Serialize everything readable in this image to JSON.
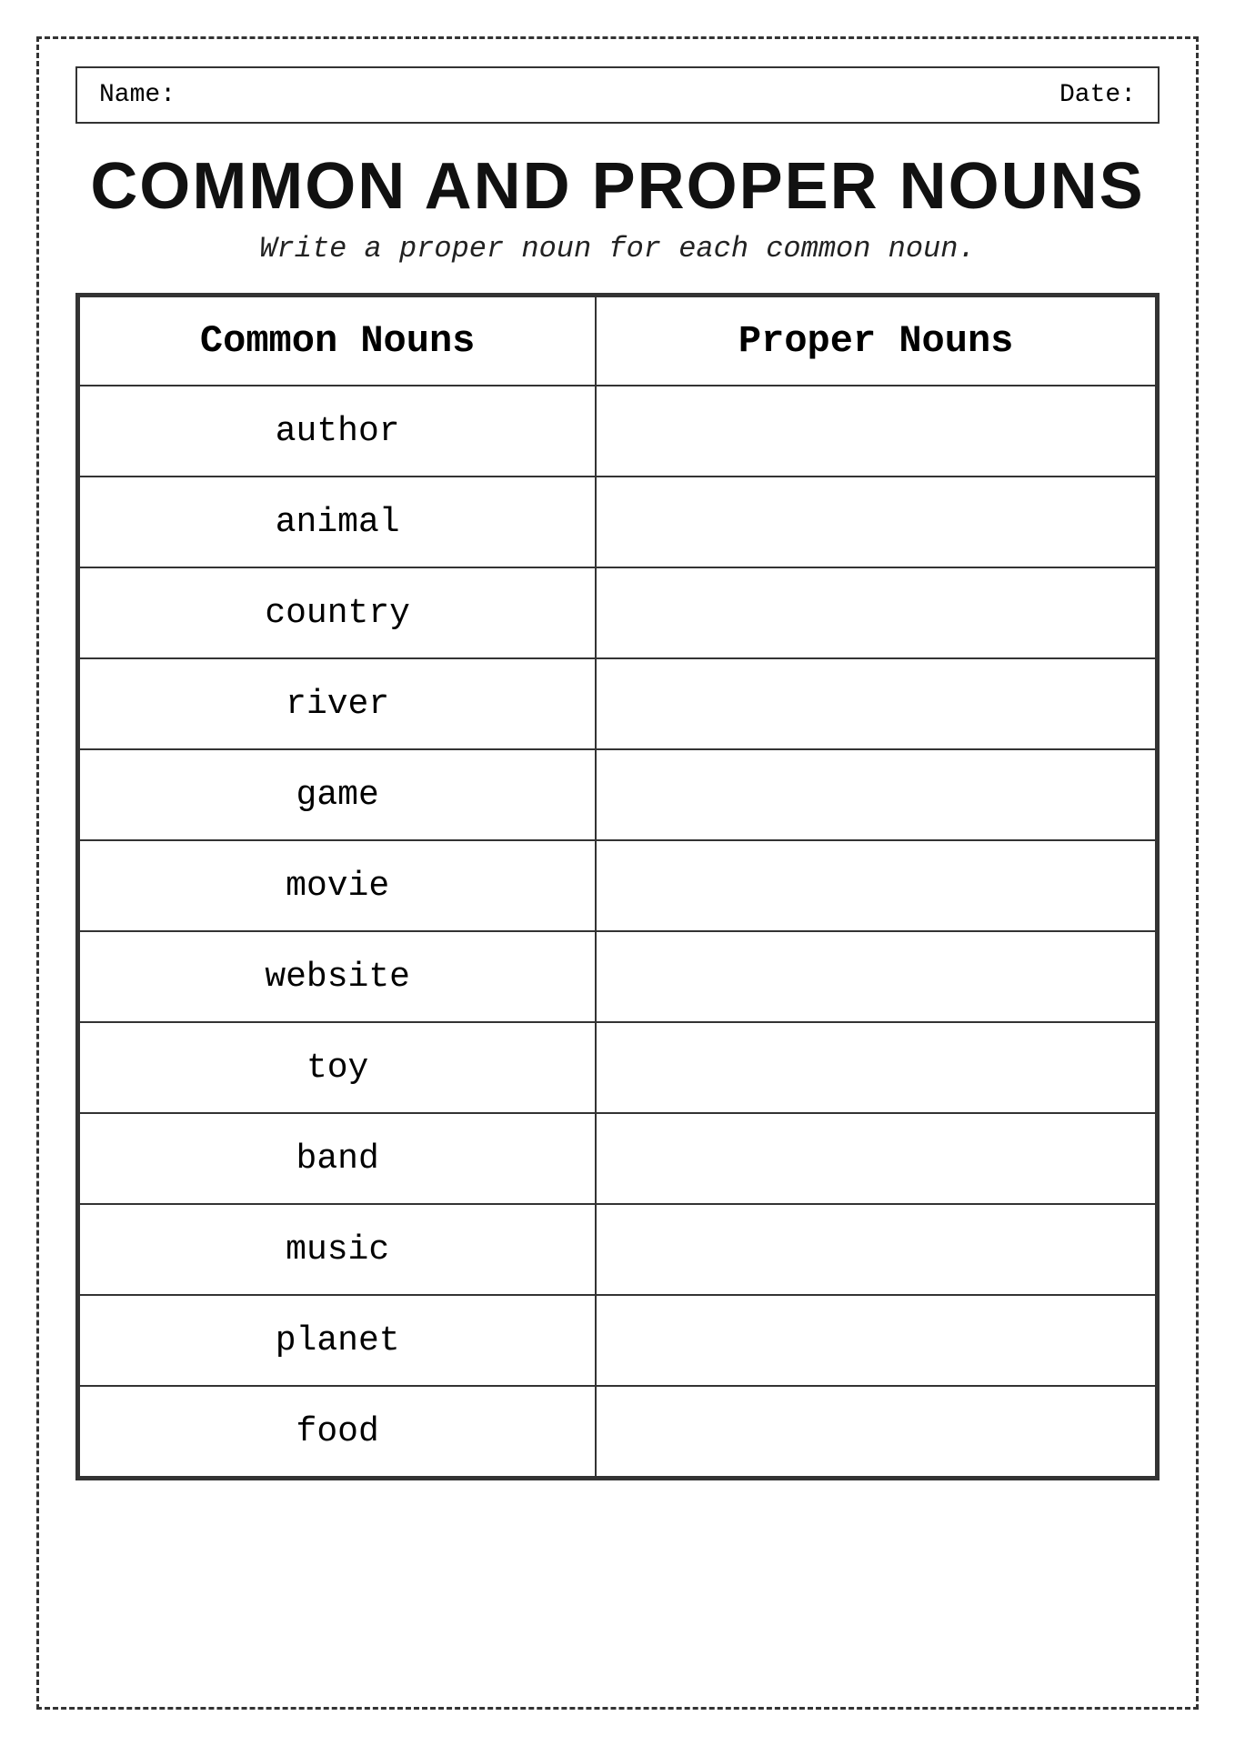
{
  "header": {
    "name_label": "Name:",
    "date_label": "Date:"
  },
  "title": "COMMON AND PROPER NOUNS",
  "subtitle": "Write a proper noun for each common noun.",
  "table": {
    "col_common": "Common Nouns",
    "col_proper": "Proper Nouns",
    "rows": [
      {
        "common": "author",
        "proper": ""
      },
      {
        "common": "animal",
        "proper": ""
      },
      {
        "common": "country",
        "proper": ""
      },
      {
        "common": "river",
        "proper": ""
      },
      {
        "common": "game",
        "proper": ""
      },
      {
        "common": "movie",
        "proper": ""
      },
      {
        "common": "website",
        "proper": ""
      },
      {
        "common": "toy",
        "proper": ""
      },
      {
        "common": "band",
        "proper": ""
      },
      {
        "common": "music",
        "proper": ""
      },
      {
        "common": "planet",
        "proper": ""
      },
      {
        "common": "food",
        "proper": ""
      }
    ]
  }
}
